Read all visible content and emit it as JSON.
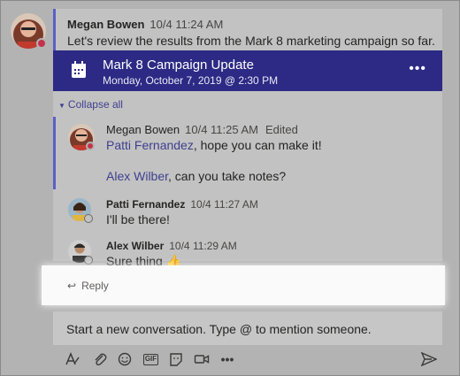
{
  "post": {
    "author": "Megan Bowen",
    "time": "10/4 11:24 AM",
    "text": "Let's review the results from the Mark 8 marketing campaign so far."
  },
  "event_card": {
    "title": "Mark 8 Campaign Update",
    "datetime": "Monday, October 7, 2019 @ 2:30 PM",
    "more": "•••"
  },
  "collapse_label": "Collapse all",
  "replies": [
    {
      "author": "Megan Bowen",
      "time": "10/4 11:25 AM",
      "edited": "Edited",
      "line1_mention": "Patti Fernandez",
      "line1_rest": ", hope you can make it!",
      "line2_mention": "Alex Wilber",
      "line2_rest": ", can you take notes?"
    },
    {
      "author": "Patti Fernandez",
      "time": "10/4 11:27 AM",
      "text": "I'll be there!"
    },
    {
      "author": "Alex Wilber",
      "time": "10/4 11:29 AM",
      "text": "Sure thing",
      "emoji": "👍"
    }
  ],
  "reply_label": "Reply",
  "compose": {
    "placeholder": "Start a new conversation. Type @ to mention someone."
  },
  "toolbar": {
    "gif_label": "GIF"
  },
  "colors": {
    "accent": "#5b5fc7",
    "event_bg": "#2c2a84",
    "status_busy": "#c4314b",
    "mention": "#3f3f8f"
  }
}
